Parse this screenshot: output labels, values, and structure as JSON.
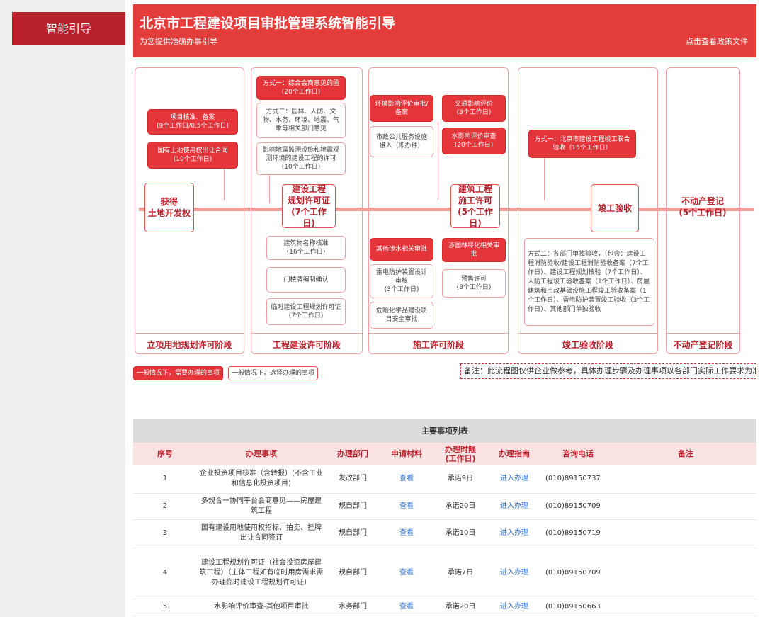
{
  "sidebar": {
    "active_item": "智能引导"
  },
  "banner": {
    "title": "北京市工程建设项目审批管理系统智能引导",
    "subtitle": "为您提供准确办事引导",
    "policy_link": "点击查看政策文件"
  },
  "flow": {
    "stages": [
      {
        "label": "立项用地规划许可阶段",
        "main": "获得\n土地开发权"
      },
      {
        "label": "工程建设许可阶段",
        "main": "建设工程\n规划许可证\n(7个工作日)"
      },
      {
        "label": "施工许可阶段",
        "main": "建筑工程\n施工许可\n(5个工作日)"
      },
      {
        "label": "竣工验收阶段",
        "main": "竣工验收"
      },
      {
        "label": "不动产登记阶段",
        "main": "不动产登记\n(5个工作日)"
      }
    ],
    "boxes": {
      "s1_b1": "项目核准、备案\n(9个工作日/0.5个工作日)",
      "s1_b2": "国有土地使用权出让合同\n(10个工作日)",
      "s2_b1": "方式一：综合会商意见的函\n(20个工作日)",
      "s2_b2": "方式二：园林、人防、文物、水务、环境、地震、气象等相关部门意见",
      "s2_b3": "影响地震监测设施和地震观测环境的建设工程的许可\n(10个工作日)",
      "s2_b4": "建筑物名称核准\n(16个工作日)",
      "s2_b5": "门楼牌编制确认",
      "s2_b6": "临时建设工程规划许可证\n(7个工作日)",
      "s3_b1": "环境影响评价审批/备案",
      "s3_b2": "交通影响评价\n(3个工作日)",
      "s3_b3": "市政公共服务设施接入（即办件）",
      "s3_b4": "水影响评价审查\n(20个工作日)",
      "s3_b5": "其他涉水相关审批",
      "s3_b6": "涉园林绿化相关审批",
      "s3_b7": "雷电防护装置设计审核\n(3个工作日)",
      "s3_b8": "预售许可\n(8个工作日)",
      "s3_b9": "危险化学品建设项目安全审批",
      "s4_b1": "方式一：北京市建设工程竣工联合验收（15个工作日）",
      "s4_b2": "方式二：各部门单独验收，（包含：建设工程消防验收/建设工程消防验收备案（7个工作日）、建设工程规划核验（7个工作日）、人防工程竣工验收备案（1个工作日）、房屋建筑和市政基础设施工程竣工验收备案（1个工作日）、雷电防护装置竣工验收（3个工作日）、其他部门单独验收"
    }
  },
  "legend": {
    "required": "一般情况下，需要办理的事项",
    "optional": "一般情况下，选择办理的事项"
  },
  "note": "备注：此流程图仅供企业做参考，具体办理步骤及办理事项以各部门实际工作要求为准",
  "table": {
    "title": "主要事项列表",
    "headers": [
      "序号",
      "办理事项",
      "办理部门",
      "申请材料",
      "办理时限\n(工作日)",
      "办理指南",
      "咨询电话",
      "备注"
    ],
    "rows": [
      {
        "no": "1",
        "item": "企业投资项目核准（含转报）(不含工业和信息化投资项目)",
        "dept": "发改部门",
        "material": "查看",
        "limit": "承诺9日",
        "guide": "进入办理",
        "phone": "(010)89150737",
        "remark": ""
      },
      {
        "no": "2",
        "item": "多规合一协同平台会商意见——房屋建筑工程",
        "dept": "规自部门",
        "material": "查看",
        "limit": "承诺20日",
        "guide": "进入办理",
        "phone": "(010)89150709",
        "remark": ""
      },
      {
        "no": "3",
        "item": "国有建设用地使用权招标、拍卖、挂牌出让合同签订",
        "dept": "规自部门",
        "material": "查看",
        "limit": "承诺10日",
        "guide": "进入办理",
        "phone": "(010)89150719",
        "remark": ""
      },
      {
        "no": "4",
        "item": "建设工程规划许可证（社会投资房屋建筑工程）（主体工程如有临时用房需求需办理临时建设工程规划许可证）",
        "dept": "规自部门",
        "material": "查看",
        "limit": "承诺7日",
        "guide": "进入办理",
        "phone": "(010)89150709",
        "remark": ""
      },
      {
        "no": "5",
        "item": "水影响评价审查-其他项目审批",
        "dept": "水务部门",
        "material": "查看",
        "limit": "承诺20日",
        "guide": "进入办理",
        "phone": "(010)89150663",
        "remark": ""
      }
    ]
  }
}
